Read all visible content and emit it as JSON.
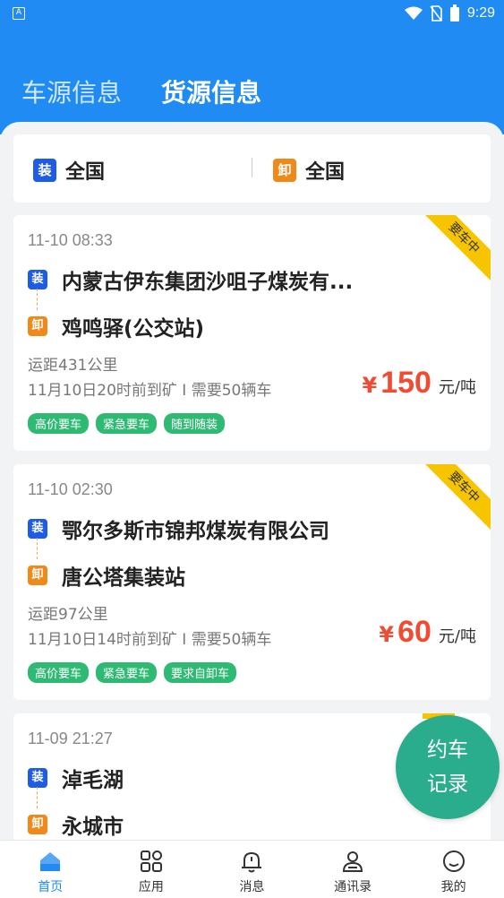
{
  "status_bar": {
    "time": "9:29",
    "app_icon": "A"
  },
  "header": {
    "tabs": [
      {
        "label": "车源信息",
        "active": false
      },
      {
        "label": "货源信息",
        "active": true
      }
    ]
  },
  "filter": {
    "load_badge": "装",
    "load_value": "全国",
    "unload_badge": "卸",
    "unload_value": "全国"
  },
  "cards": [
    {
      "time": "11-10 08:33",
      "ribbon": "要车中",
      "load_badge": "装",
      "from": "内蒙古伊东集团沙咀子煤炭有...",
      "unload_badge": "卸",
      "to": "鸡鸣驿(公交站)",
      "distance": "运距431公里",
      "detail": "11月10日20时前到矿 I 需要50辆车",
      "yen": "¥",
      "price": "150",
      "unit": "元/吨",
      "tags": [
        "高价要车",
        "紧急要车",
        "随到随装"
      ]
    },
    {
      "time": "11-10 02:30",
      "ribbon": "要车中",
      "load_badge": "装",
      "from": "鄂尔多斯市锦邦煤炭有限公司",
      "unload_badge": "卸",
      "to": "唐公塔集装站",
      "distance": "运距97公里",
      "detail": "11月10日14时前到矿 I 需要50辆车",
      "yen": "¥",
      "price": "60",
      "unit": "元/吨",
      "tags": [
        "高价要车",
        "紧急要车",
        "要求自卸车"
      ]
    },
    {
      "time": "11-09 21:27",
      "load_badge": "装",
      "from": "淖毛湖",
      "unload_badge": "卸",
      "to": "永城市"
    }
  ],
  "fab": {
    "line1": "约车",
    "line2": "记录"
  },
  "nav": {
    "items": [
      {
        "label": "首页",
        "icon": "home-icon",
        "active": true
      },
      {
        "label": "应用",
        "icon": "apps-icon",
        "active": false
      },
      {
        "label": "消息",
        "icon": "bell-icon",
        "active": false
      },
      {
        "label": "通讯录",
        "icon": "contacts-icon",
        "active": false
      },
      {
        "label": "我的",
        "icon": "profile-icon",
        "active": false
      }
    ]
  },
  "colors": {
    "primary": "#1f8bf3",
    "price": "#f04b33",
    "tag": "#2fba73",
    "ribbon": "#f7c500",
    "fab": "#2aad8c"
  }
}
